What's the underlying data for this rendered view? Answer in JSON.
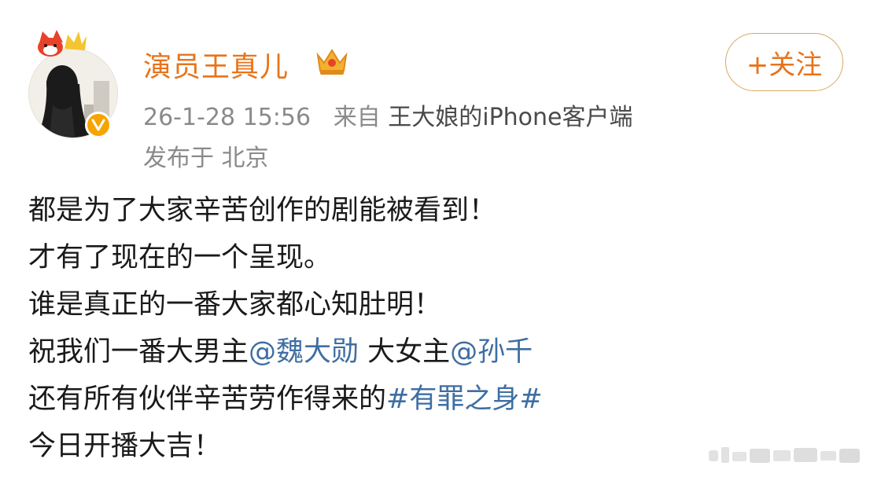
{
  "user": {
    "name": "演员王真儿",
    "badge_icon": "crown-vip-icon",
    "verified_icon": "verified-v-icon"
  },
  "post_meta": {
    "time": "26-1-28 15:56",
    "from_label": "来自",
    "source": "王大娘的iPhone客户端",
    "location": "发布于 北京"
  },
  "follow_button": {
    "label": "+关注"
  },
  "content": {
    "line1": "都是为了大家辛苦创作的剧能被看到！",
    "line2": "才有了现在的一个呈现。",
    "line3": "谁是真正的一番大家都心知肚明！",
    "line4_text1": "祝我们一番大男主",
    "line4_mention1": "@魏大勋",
    "line4_text2": " 大女主",
    "line4_mention2": "@孙千",
    "line5_text": "还有所有伙伴辛苦劳作得来的",
    "line5_hashtag": "#有罪之身#",
    "line6": "今日开播大吉！"
  },
  "colors": {
    "username": "#e8741b",
    "link": "#3f6ea3",
    "meta": "#8a8a8a",
    "verified": "#f6a400"
  }
}
